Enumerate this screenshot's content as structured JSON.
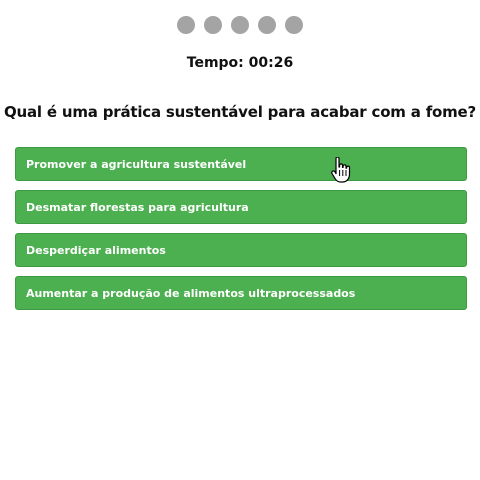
{
  "progress": {
    "dots": [
      "",
      "",
      "",
      "",
      ""
    ]
  },
  "timer": {
    "text": "Tempo: 00:26"
  },
  "question": {
    "text": "Qual é uma prática sustentável para acabar com a fome?"
  },
  "options": [
    {
      "label": "Promover a agricultura sustentável"
    },
    {
      "label": "Desmatar florestas para agricultura"
    },
    {
      "label": "Desperdiçar alimentos"
    },
    {
      "label": "Aumentar a produção de alimentos ultraprocessados"
    }
  ],
  "colors": {
    "option_background": "#4caf50",
    "dot": "#a4a4a4",
    "text": "#111111"
  },
  "cursor": {
    "icon": "hand-pointer-icon"
  }
}
